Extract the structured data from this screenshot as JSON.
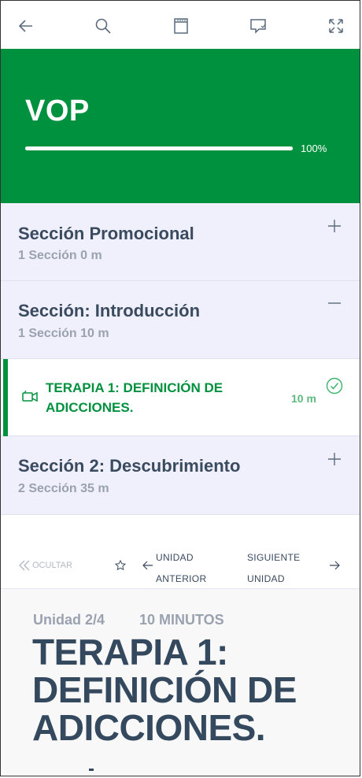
{
  "toolbar": {
    "icons": [
      "back-arrow-icon",
      "search-icon",
      "notebook-icon",
      "chat-icon",
      "fullscreen-icon"
    ]
  },
  "course": {
    "title": "VOP",
    "progress_percent": 100,
    "progress_label": "100%"
  },
  "sections": [
    {
      "title": "Sección Promocional",
      "meta": "1 Sección  0 m",
      "toggle": "+"
    },
    {
      "title": "Sección: Introducción",
      "meta": "1 Sección  10 m",
      "toggle": "−"
    },
    {
      "title": "Sección 2: Descubrimiento",
      "meta": "2 Sección  35 m",
      "toggle": "+"
    }
  ],
  "active_lesson": {
    "title": "TERAPIA 1: DEFINICIÓN DE ADICCIONES.",
    "duration": "10 m",
    "completed": true
  },
  "nav": {
    "hide_label": "OCULTAR",
    "prev_line1": "UNIDAD",
    "prev_line2": "ANTERIOR",
    "next_line1": "SIGUIENTE",
    "next_line2": "UNIDAD"
  },
  "content": {
    "unit_label": "Unidad 2/4",
    "minutes_label": "10 MINUTOS",
    "title": "TERAPIA 1: DEFINICIÓN DE ADICCIONES."
  },
  "colors": {
    "brand_green": "#00913e",
    "section_bg": "#eff0fb",
    "title_dark": "#34495e"
  }
}
